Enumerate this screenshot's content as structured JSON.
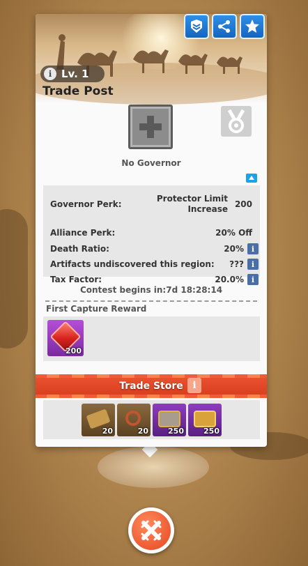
{
  "header": {
    "level_label": "Lv. 1",
    "info_glyph": "i",
    "building_title": "Trade Post",
    "buttons": [
      {
        "name": "rank-badge-icon"
      },
      {
        "name": "share-icon"
      },
      {
        "name": "star-icon"
      }
    ]
  },
  "governor": {
    "status": "No Governor"
  },
  "stats": [
    {
      "label": "Governor Perk:",
      "value_line1": "Protector Limit",
      "value_line2": "Increase",
      "value": "200"
    },
    {
      "label": "Alliance Perk:",
      "value": "20% Off"
    },
    {
      "label": "Death Ratio:",
      "value": "20%"
    },
    {
      "label": "Artifacts undiscovered this region:",
      "value": "???"
    },
    {
      "label": "Tax Factor:",
      "value": "20.0%"
    }
  ],
  "contest": {
    "text": "Contest begins in:7d 18:28:14"
  },
  "first_capture": {
    "title": "First Capture Reward",
    "rewards": [
      {
        "icon": "ruby-icon",
        "quantity": "200"
      }
    ]
  },
  "trade_store": {
    "label": "Trade Store",
    "info_glyph": "i",
    "items": [
      {
        "icon": "scroll-icon",
        "quantity": "20"
      },
      {
        "icon": "amulet-icon",
        "quantity": "20"
      },
      {
        "icon": "treasure-chest-icon",
        "quantity": "250"
      },
      {
        "icon": "gold-chest-icon",
        "quantity": "250"
      }
    ]
  },
  "colors": {
    "accent_blue": "#1e7bd8",
    "store_orange": "#e8502f",
    "close_orange": "#f05a2a",
    "epic_purple": "#9b3fc6",
    "panel_bg": "#fafafa"
  }
}
